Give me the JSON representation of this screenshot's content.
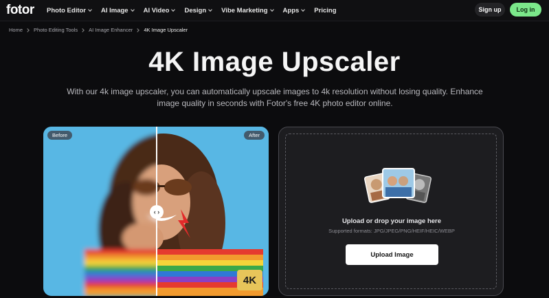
{
  "nav": {
    "logo": "fotor",
    "menu": [
      {
        "label": "Photo Editor",
        "dropdown": true
      },
      {
        "label": "AI Image",
        "dropdown": true
      },
      {
        "label": "AI Video",
        "dropdown": true
      },
      {
        "label": "Design",
        "dropdown": true
      },
      {
        "label": "Vibe Marketing",
        "dropdown": true
      },
      {
        "label": "Apps",
        "dropdown": true
      },
      {
        "label": "Pricing",
        "dropdown": false
      }
    ],
    "signup_label": "Sign up",
    "login_label": "Log in",
    "accent_color": "#7be88a"
  },
  "breadcrumb": [
    "Home",
    "Photo Editing Tools",
    "AI Image Enhancer",
    "4K Image Upscaler"
  ],
  "hero": {
    "title": "4K Image Upscaler",
    "subtitle": "With our 4k image upscaler, you can automatically upscale images to 4k resolution without losing quality. Enhance image quality in seconds with Fotor's free 4K photo editor online."
  },
  "compare": {
    "before_label": "Before",
    "after_label": "After",
    "handle_glyph": "‹ ›",
    "badge": "4K"
  },
  "upload": {
    "title": "Upload or drop your image here",
    "formats": "Supported formats: JPG/JPEG/PNG/HEIF/HEIC/WEBP",
    "button_label": "Upload Image"
  }
}
